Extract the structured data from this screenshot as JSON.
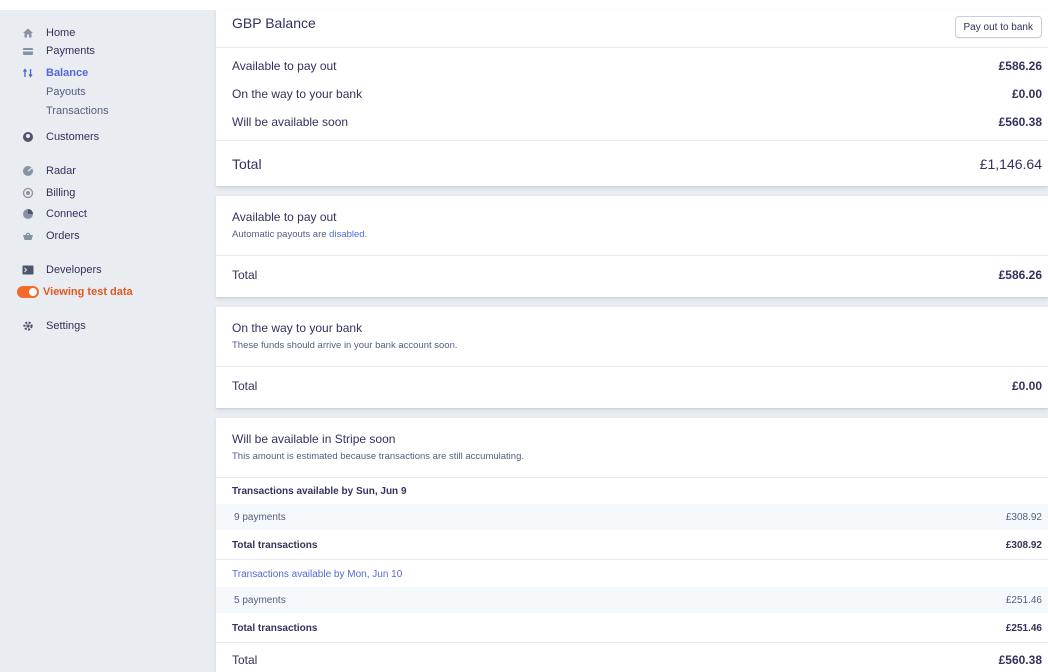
{
  "sidebar": {
    "items": [
      {
        "label": "Home",
        "icon": "home-icon"
      },
      {
        "label": "Payments",
        "icon": "payments-icon"
      },
      {
        "label": "Balance",
        "icon": "balance-icon",
        "active": true
      },
      {
        "label": "Customers",
        "icon": "customers-icon"
      },
      {
        "label": "Radar",
        "icon": "radar-icon"
      },
      {
        "label": "Billing",
        "icon": "billing-icon"
      },
      {
        "label": "Connect",
        "icon": "connect-icon"
      },
      {
        "label": "Orders",
        "icon": "orders-icon"
      },
      {
        "label": "Developers",
        "icon": "developers-icon"
      },
      {
        "label": "Settings",
        "icon": "settings-icon"
      }
    ],
    "balance_sub": [
      "Payouts",
      "Transactions"
    ],
    "test_mode": {
      "label": "Viewing test data",
      "color": "#f26a2e"
    }
  },
  "summary": {
    "title": "GBP Balance",
    "payout_button": "Pay out to bank",
    "rows": [
      {
        "label": "Available to pay out",
        "amount": "£586.26"
      },
      {
        "label": "On the way to your bank",
        "amount": "£0.00"
      },
      {
        "label": "Will be available soon",
        "amount": "£560.38"
      }
    ],
    "total_label": "Total",
    "total_amount": "£1,146.64"
  },
  "available": {
    "title": "Available to pay out",
    "subtitle_prefix": "Automatic payouts are",
    "subtitle_link": "disabled.",
    "total_label": "Total",
    "total_amount": "£586.26"
  },
  "on_the_way": {
    "title": "On the way to your bank",
    "subtitle": "These funds should arrive in your bank account soon.",
    "total_label": "Total",
    "total_amount": "£0.00"
  },
  "soon": {
    "title": "Will be available in Stripe soon",
    "subtitle": "This amount is estimated because transactions are still accumulating.",
    "groups": [
      {
        "heading": "Transactions available by Sun, Jun 9",
        "payments_label": "9 payments",
        "payments_amount": "£308.92",
        "total_label": "Total transactions",
        "total_amount": "£308.92"
      },
      {
        "heading": "Transactions available by Mon, Jun 10",
        "payments_label": "5 payments",
        "payments_amount": "£251.46",
        "total_label": "Total transactions",
        "total_amount": "£251.46"
      }
    ],
    "total_label": "Total",
    "total_amount": "£560.38"
  },
  "colors": {
    "accent": "#5469d4",
    "text": "#32325d",
    "background": "#e9ecf1",
    "test_orange": "#f26a2e"
  }
}
